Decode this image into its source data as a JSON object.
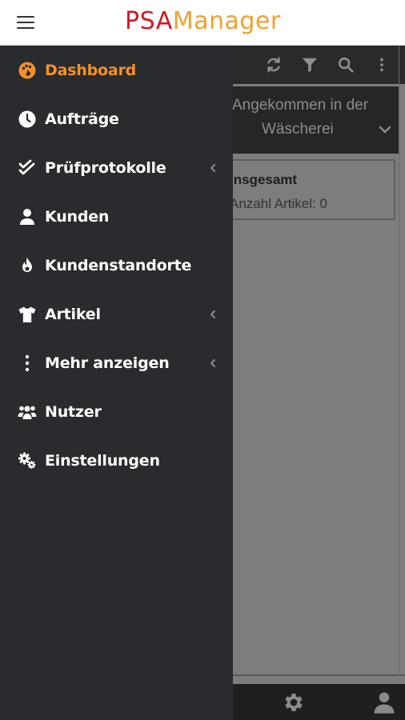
{
  "header": {
    "title_part1": "PSA",
    "title_part2": "Manager",
    "title_colors": {
      "part1": "#d01a22",
      "part2": "#f0a030"
    },
    "menu_icon": "hamburger-icon"
  },
  "sidebar": {
    "accent_color": "#f2912a",
    "items": [
      {
        "label": "Dashboard",
        "icon": "palette-icon",
        "active": true,
        "has_submenu": false
      },
      {
        "label": "Aufträge",
        "icon": "clock-icon",
        "active": false,
        "has_submenu": false
      },
      {
        "label": "Prüfprotokolle",
        "icon": "double-check-icon",
        "active": false,
        "has_submenu": true
      },
      {
        "label": "Kunden",
        "icon": "user-icon",
        "active": false,
        "has_submenu": false
      },
      {
        "label": "Kundenstandorte",
        "icon": "fire-icon",
        "active": false,
        "has_submenu": false
      },
      {
        "label": "Artikel",
        "icon": "shirt-icon",
        "active": false,
        "has_submenu": true
      },
      {
        "label": "Mehr anzeigen",
        "icon": "vertical-dots-icon",
        "active": false,
        "has_submenu": true
      },
      {
        "label": "Nutzer",
        "icon": "users-icon",
        "active": false,
        "has_submenu": false
      },
      {
        "label": "Einstellungen",
        "icon": "cogs-icon",
        "active": false,
        "has_submenu": false
      }
    ]
  },
  "background": {
    "toolbar_icons": [
      "refresh-icon",
      "filter-icon",
      "search-icon",
      "more-vertical-icon"
    ],
    "status_filter": {
      "line1": "Angekommen in der",
      "line2": "Wäscherei"
    },
    "summary_card": {
      "title": "Insgesamt",
      "count_text": "Anzahl Artikel: 0"
    },
    "bottom_nav_icons": [
      "gear-icon",
      "profile-icon"
    ]
  }
}
